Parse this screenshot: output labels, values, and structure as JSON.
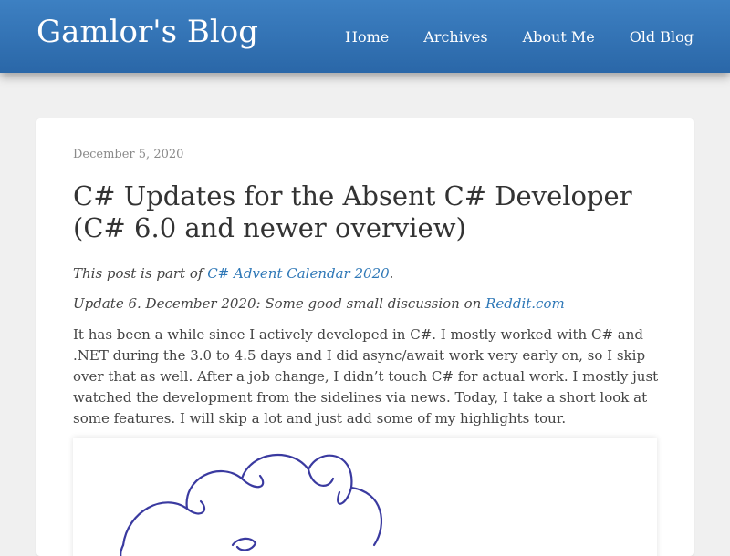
{
  "header": {
    "site_title": "Gamlor's Blog",
    "nav": [
      "Home",
      "Archives",
      "About Me",
      "Old Blog"
    ]
  },
  "post": {
    "date": "December 5, 2020",
    "title": "C# Updates for the Absent C# Developer (C# 6.0 and newer overview)",
    "series_prefix": "This post is part of ",
    "series_link": "C# Advent Calendar 2020",
    "series_suffix": ".",
    "update_prefix": "Update 6. December 2020: Some good small discussion on ",
    "update_link": "Reddit.com",
    "body": "It has been a while since I actively developed in C#. I mostly worked with C# and .NET during the 3.0 to 4.5 days and I did async/await work very early on, so I skip over that as well. After a job change, I didn’t touch C# for actual work. I mostly just watched the development from the sidelines via news. Today, I take a short look at some features. I will skip a lot and just add some of my highlights tour.",
    "image_icon": "handdrawn-cloud-sketch"
  },
  "colors": {
    "header": "#2f6fb0",
    "link": "#2f78b7",
    "sketch": "#3a3aa0"
  }
}
